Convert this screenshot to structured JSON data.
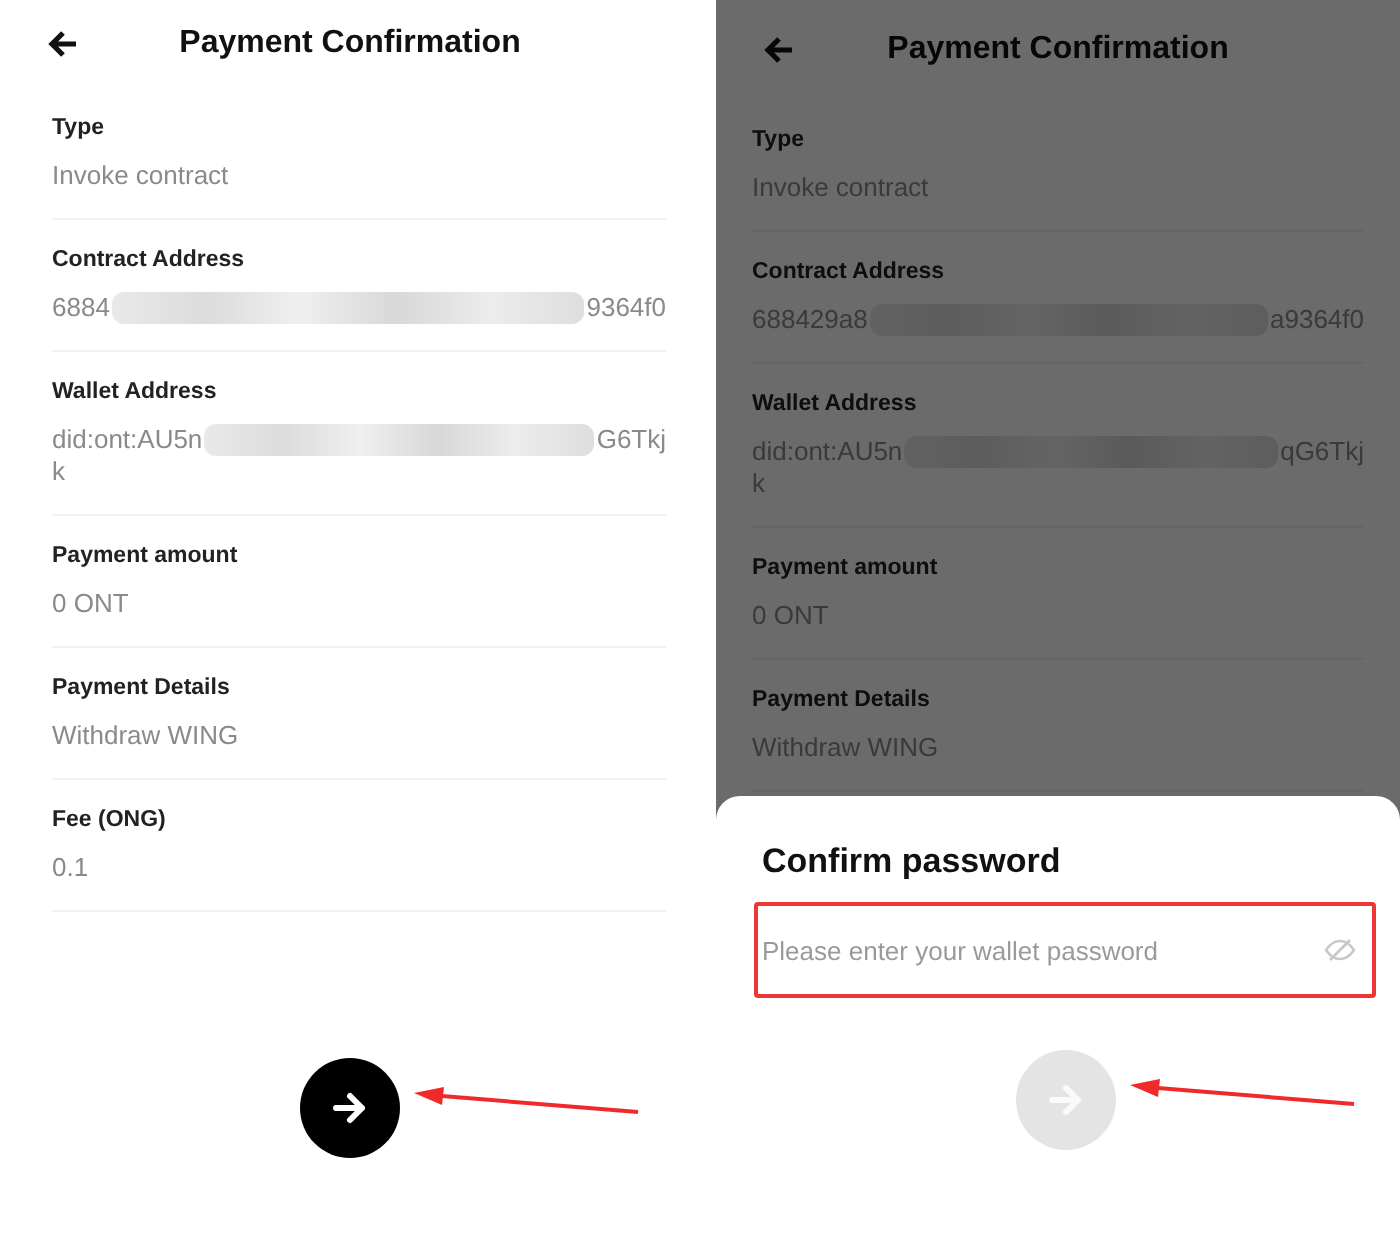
{
  "screens": [
    {
      "title": "Payment Confirmation",
      "dimmed": false,
      "fields": [
        {
          "label": "Type",
          "value": "Invoke contract"
        },
        {
          "label": "Contract Address",
          "value": "6884",
          "redacted": true,
          "value_end": "9364f0"
        },
        {
          "label": "Wallet Address",
          "value": "did:ont:AU5n",
          "redacted": true,
          "value_end": "G6Tkj",
          "value_wrap": "k"
        },
        {
          "label": "Payment amount",
          "value": "0 ONT"
        },
        {
          "label": "Payment Details",
          "value": "Withdraw WING"
        },
        {
          "label": "Fee (ONG)",
          "value": "0.1"
        }
      ],
      "confirm_button": {
        "disabled": false,
        "pointer_arrow": true
      }
    },
    {
      "title": "Payment Confirmation",
      "dimmed": true,
      "fields": [
        {
          "label": "Type",
          "value": "Invoke contract"
        },
        {
          "label": "Contract Address",
          "value": "688429a8",
          "redacted": true,
          "value_end": "a9364f0"
        },
        {
          "label": "Wallet Address",
          "value": "did:ont:AU5n",
          "redacted": true,
          "value_end": "qG6Tkj",
          "value_wrap": "k"
        },
        {
          "label": "Payment amount",
          "value": "0 ONT"
        },
        {
          "label": "Payment Details",
          "value": "Withdraw WING"
        }
      ],
      "sheet": {
        "title": "Confirm password",
        "password_field": {
          "placeholder": "Please enter your wallet password",
          "highlighted": true
        },
        "confirm_button": {
          "disabled": true,
          "pointer_arrow": true
        }
      }
    }
  ]
}
